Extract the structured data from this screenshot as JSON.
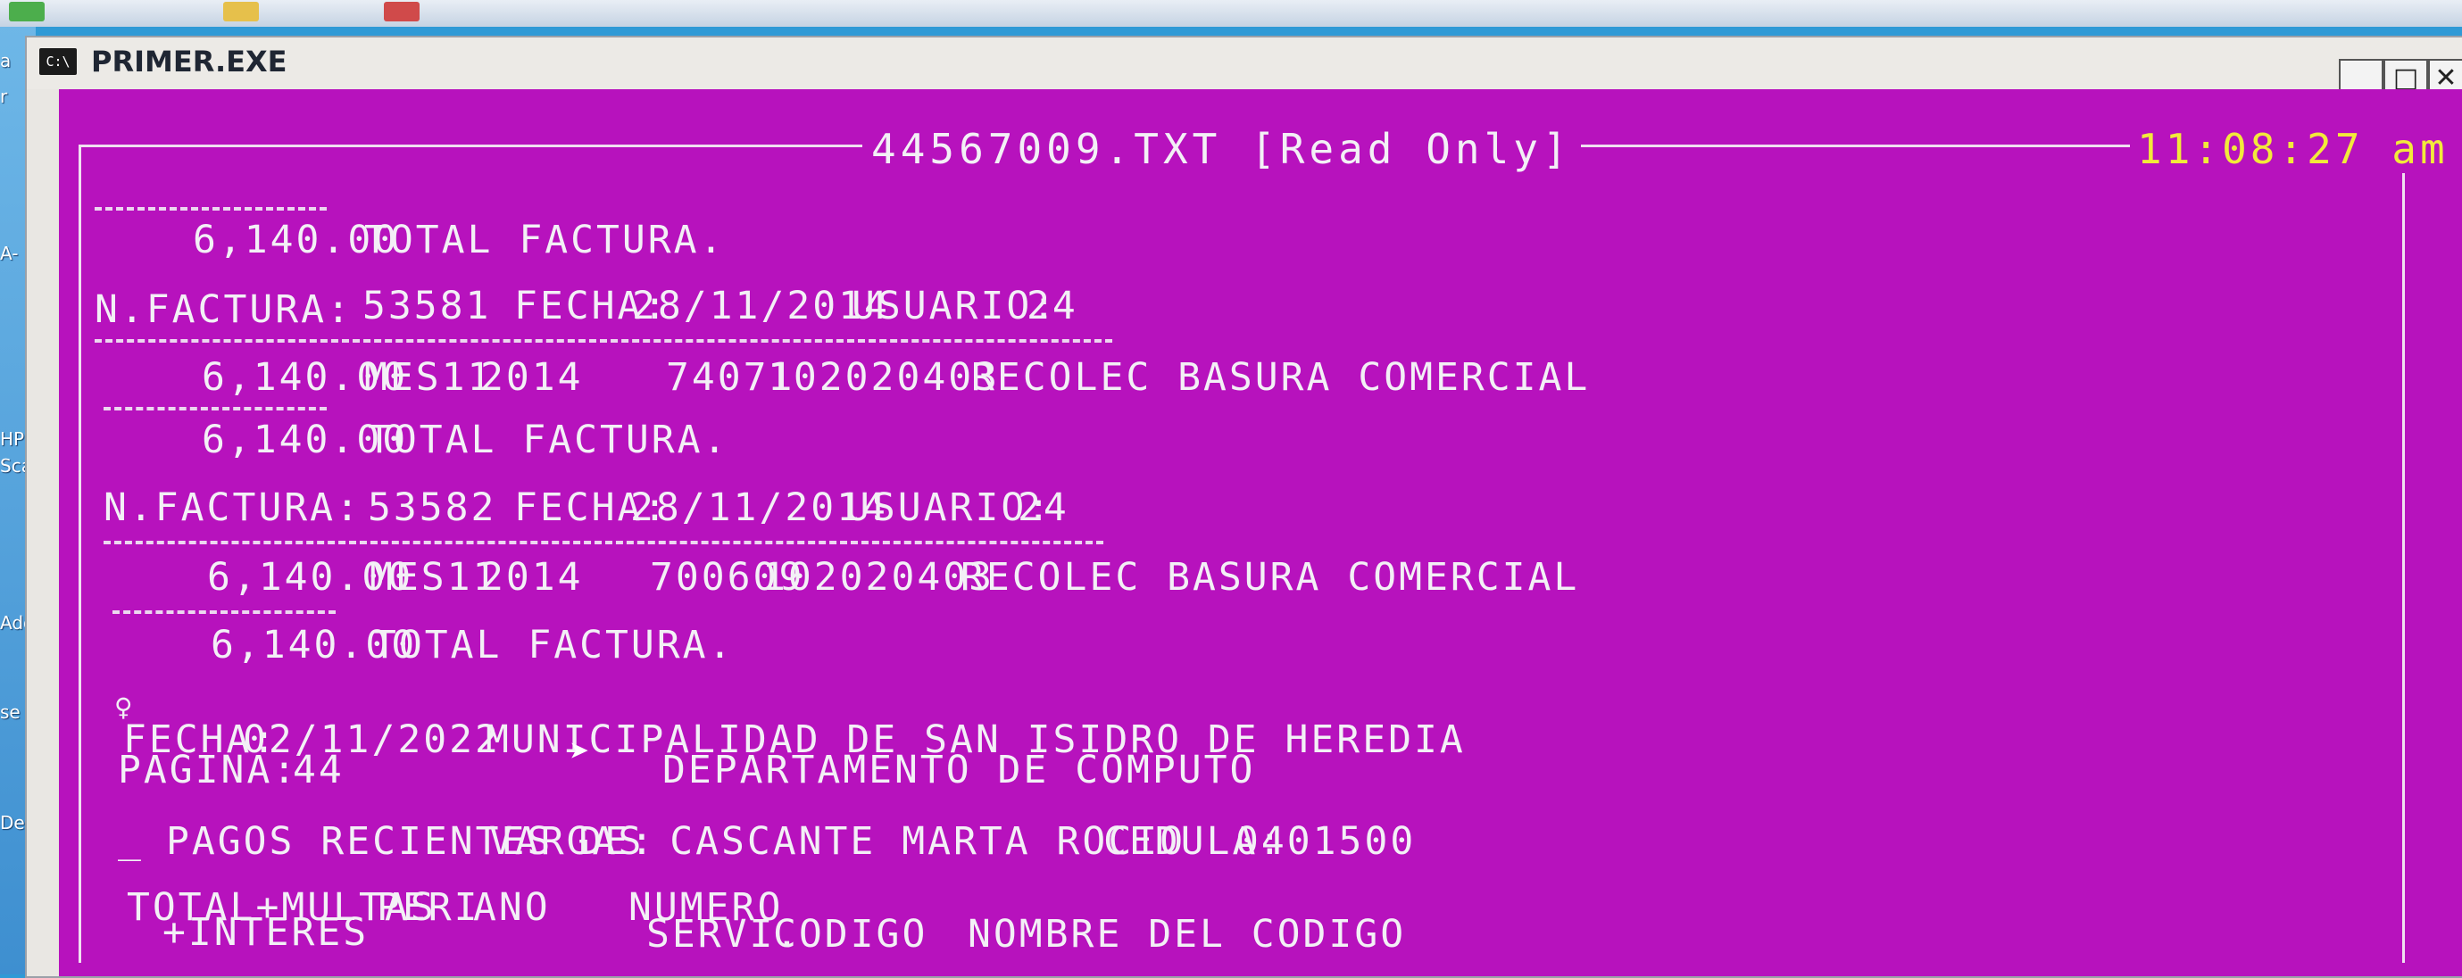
{
  "desktop": {
    "labels": [
      "a",
      "r",
      "A-",
      "HP",
      "Sca",
      "Ado",
      "se",
      "Des"
    ]
  },
  "window": {
    "title": "PRIMER.EXE",
    "icon_label": "C:\\",
    "minimize_label": "_",
    "maximize_label": "□",
    "close_label": "✕"
  },
  "viewer": {
    "file_title": "44567009.TXT [Read Only]",
    "clock": "11:08:27 am"
  },
  "invoices_top": {
    "total_amount": "6,140.00",
    "total_label": "TOTAL FACTURA."
  },
  "invoices": [
    {
      "factura_label": "N.FACTURA:",
      "factura_num": "53581",
      "fecha_label": "FECHA:",
      "fecha": "28/11/2014",
      "usuario_label": "USUARIO:",
      "usuario": "24",
      "amount": "6,140.00",
      "mes": "MES11",
      "year": "2014",
      "service_num": "74071",
      "code": "102020403",
      "desc": "RECOLEC BASURA COMERCIAL",
      "total_amount": "6,140.00",
      "total_label": "TOTAL FACTURA."
    },
    {
      "factura_label": "N.FACTURA:",
      "factura_num": "53582",
      "fecha_label": "FECHA:",
      "fecha": "28/11/2014",
      "usuario_label": "USUARIO:",
      "usuario": "24",
      "amount": "6,140.00",
      "mes": "MES11",
      "year": "2014",
      "service_num": "700609",
      "code": "102020403",
      "desc": "RECOLEC BASURA COMERCIAL",
      "total_amount": "6,140.00",
      "total_label": "TOTAL FACTURA."
    }
  ],
  "report": {
    "symbol": "♀",
    "fecha_label": "FECHA:",
    "fecha": "02/11/2022",
    "institution": "MUNICIPALIDAD DE SAN ISIDRO DE HEREDIA",
    "pagina_label": "PAGINA:",
    "pagina": "44",
    "department": "DEPARTAMENTO DE COMPUTO",
    "underscore": "_",
    "pagos_label": "PAGOS RECIENTES DE:",
    "person": "VARGAS CASCANTE MARTA ROCIO",
    "cedula_label": "CEDULA:",
    "cedula": "0401500"
  },
  "columns": {
    "total_multas": "TOTAL+MULTAS",
    "interes": "+INTERES",
    "peri": "PERI",
    "ano": "ANO",
    "numero": "NUMERO",
    "servi": "SERVI.",
    "codigo": "CODIGO",
    "nombre": "NOMBRE DEL CODIGO"
  },
  "colors": {
    "console_bg": "#b712bd",
    "console_text": "#f3f0f6",
    "clock": "#f2ea3a"
  }
}
